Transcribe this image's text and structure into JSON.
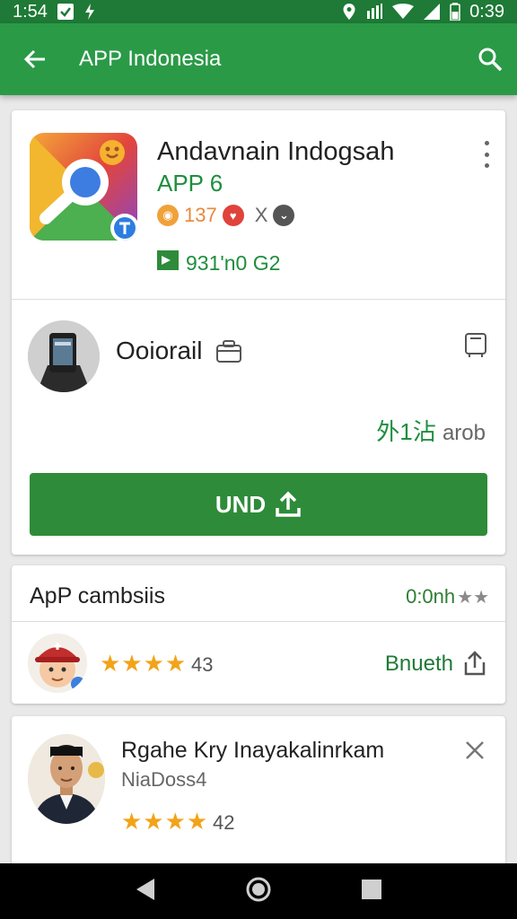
{
  "status_bar": {
    "time": "1:54",
    "right_time": "0:39"
  },
  "app_bar": {
    "title": "APP Indonesia"
  },
  "app_card": {
    "name": "Andavnain Indogsah",
    "subtitle": "APP 6",
    "rating_value": "137",
    "rating_extra": "X",
    "price_text": "931'n0 G2",
    "developer": "Ooiorail",
    "downloads_value": "外1沾",
    "downloads_unit": "arob",
    "install_label": "UND"
  },
  "reviews_card": {
    "title": "ApP cambsiis",
    "meta": "0:0nh",
    "meta_stars": "★★",
    "stars": "★★★★",
    "count": "43",
    "share_label": "Bnueth"
  },
  "review2_card": {
    "name": "Rgahe Kry Inayakalinrkam",
    "subtitle": "NiaDoss4",
    "stars": "★★★★",
    "count": "42"
  },
  "colors": {
    "brand_green": "#2a9a47",
    "status_green": "#1e7a36",
    "button_green": "#2e8b3a",
    "star": "#f2a318"
  }
}
